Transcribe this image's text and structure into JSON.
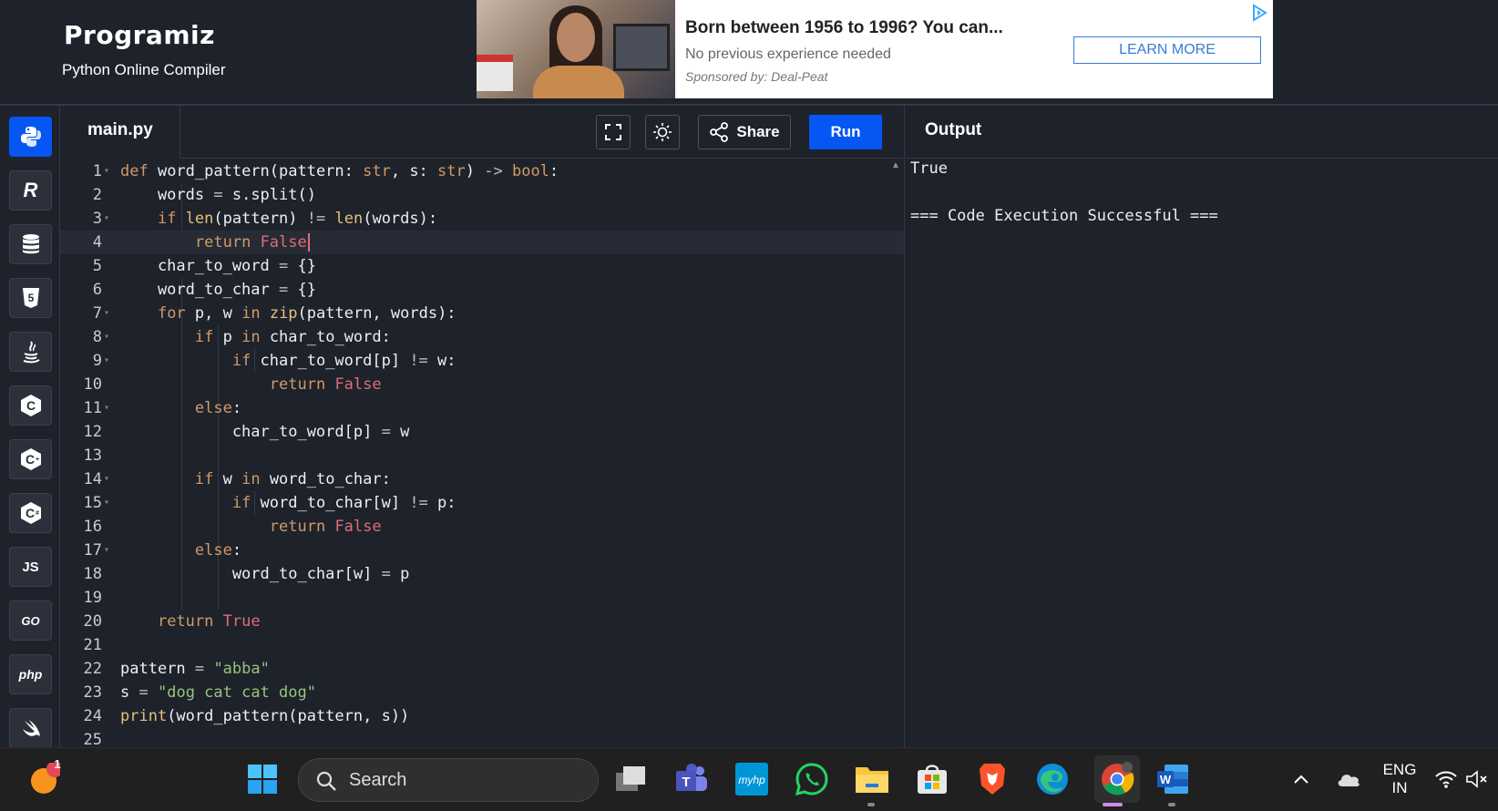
{
  "header": {
    "logo": "Programiz",
    "subtitle": "Python Online Compiler"
  },
  "ad": {
    "title": "Born between 1956 to 1996? You can...",
    "description": "No previous experience needed",
    "sponsor": "Sponsored by: Deal-Peat",
    "cta": "LEARN MORE"
  },
  "languages": [
    {
      "name": "python",
      "label": "",
      "active": true
    },
    {
      "name": "r",
      "label": "R"
    },
    {
      "name": "sql",
      "label": ""
    },
    {
      "name": "html",
      "label": "5"
    },
    {
      "name": "java",
      "label": ""
    },
    {
      "name": "c",
      "label": "C"
    },
    {
      "name": "cpp",
      "label": "C"
    },
    {
      "name": "csharp",
      "label": "C"
    },
    {
      "name": "js",
      "label": "JS"
    },
    {
      "name": "go",
      "label": "GO"
    },
    {
      "name": "php",
      "label": "php"
    },
    {
      "name": "swift",
      "label": ""
    }
  ],
  "editor": {
    "filename": "main.py",
    "share_label": "Share",
    "run_label": "Run",
    "lines": [
      {
        "n": "1",
        "fold": true,
        "html": "<span class=\"kw\">def</span> word_pattern(pattern: <span class=\"kw\">str</span>, s: <span class=\"kw\">str</span>) <span class=\"op\">-&gt;</span> <span class=\"kw\">bool</span>:"
      },
      {
        "n": "2",
        "html": "    words <span class=\"op\">=</span> s.split()"
      },
      {
        "n": "3",
        "fold": true,
        "html": "    <span class=\"kw\">if</span> <span class=\"fn\">len</span>(pattern) <span class=\"op\">!=</span> <span class=\"fn\">len</span>(words):"
      },
      {
        "n": "4",
        "current": true,
        "html": "        <span class=\"kw\">return</span> <span class=\"lit\">False</span>"
      },
      {
        "n": "5",
        "html": "    char_to_word <span class=\"op\">=</span> {}"
      },
      {
        "n": "6",
        "html": "    word_to_char <span class=\"op\">=</span> {}"
      },
      {
        "n": "7",
        "fold": true,
        "html": "    <span class=\"kw\">for</span> p, w <span class=\"kw\">in</span> <span class=\"fn\">zip</span>(pattern, words):"
      },
      {
        "n": "8",
        "fold": true,
        "html": "        <span class=\"kw\">if</span> p <span class=\"kw\">in</span> char_to_word:"
      },
      {
        "n": "9",
        "fold": true,
        "html": "            <span class=\"kw\">if</span> char_to_word[p] <span class=\"op\">!=</span> w:"
      },
      {
        "n": "10",
        "html": "                <span class=\"kw\">return</span> <span class=\"lit\">False</span>"
      },
      {
        "n": "11",
        "fold": true,
        "html": "        <span class=\"kw\">else</span>:"
      },
      {
        "n": "12",
        "html": "            char_to_word[p] <span class=\"op\">=</span> w"
      },
      {
        "n": "13",
        "html": ""
      },
      {
        "n": "14",
        "fold": true,
        "html": "        <span class=\"kw\">if</span> w <span class=\"kw\">in</span> word_to_char:"
      },
      {
        "n": "15",
        "fold": true,
        "html": "            <span class=\"kw\">if</span> word_to_char[w] <span class=\"op\">!=</span> p:"
      },
      {
        "n": "16",
        "html": "                <span class=\"kw\">return</span> <span class=\"lit\">False</span>"
      },
      {
        "n": "17",
        "fold": true,
        "html": "        <span class=\"kw\">else</span>:"
      },
      {
        "n": "18",
        "html": "            word_to_char[w] <span class=\"op\">=</span> p"
      },
      {
        "n": "19",
        "html": ""
      },
      {
        "n": "20",
        "html": "    <span class=\"kw\">return</span> <span class=\"lit\">True</span>"
      },
      {
        "n": "21",
        "html": ""
      },
      {
        "n": "22",
        "html": "pattern <span class=\"op\">=</span> <span class=\"str\">\"abba\"</span>"
      },
      {
        "n": "23",
        "html": "s <span class=\"op\">=</span> <span class=\"str\">\"dog cat cat dog\"</span>"
      },
      {
        "n": "24",
        "html": "<span class=\"fn\">print</span>(word_pattern(pattern, s))"
      },
      {
        "n": "25",
        "html": ""
      }
    ]
  },
  "output": {
    "title": "Output",
    "lines": [
      "True",
      "",
      "=== Code Execution Successful ==="
    ]
  },
  "taskbar": {
    "search_label": "Search",
    "notification_count": "1",
    "lang_line1": "ENG",
    "lang_line2": "IN"
  }
}
